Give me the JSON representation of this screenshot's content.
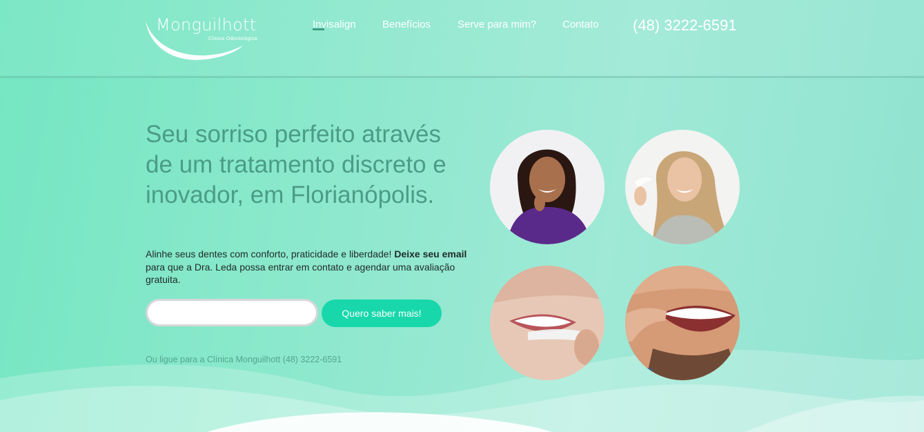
{
  "brand": {
    "name": "Monguilhott",
    "subtitle": "Clínica Odontológica"
  },
  "nav": {
    "items": [
      {
        "label": "Invisalign",
        "active": true
      },
      {
        "label": "Benefícios",
        "active": false
      },
      {
        "label": "Serve para mim?",
        "active": false
      },
      {
        "label": "Contato",
        "active": false
      }
    ],
    "phone": "(48) 3222-6591"
  },
  "hero": {
    "headline": "Seu sorriso perfeito através de um tratamento discreto e inovador, em Florianópolis.",
    "intro_text_1": "Alinhe seus dentes com conforto, praticidade e liberdade! ",
    "intro_bold": "Deixe seu email",
    "intro_text_2": " para que a Dra. Leda possa entrar em contato e agendar uma avaliação gratuita.",
    "email_placeholder": "",
    "cta_label": "Quero saber mais!",
    "call_text": "Ou ligue para a Clínica Monguilhott (48) 3222-6591"
  },
  "photos": [
    {
      "icon": "woman-curly-hair-aligner-photo"
    },
    {
      "icon": "woman-blonde-aligner-photo"
    },
    {
      "icon": "smile-aligner-closeup-photo"
    },
    {
      "icon": "man-inserting-aligner-photo"
    }
  ],
  "colors": {
    "accent": "#18d8ab",
    "headline": "#4b9c86",
    "background": "#8ce8cc"
  }
}
